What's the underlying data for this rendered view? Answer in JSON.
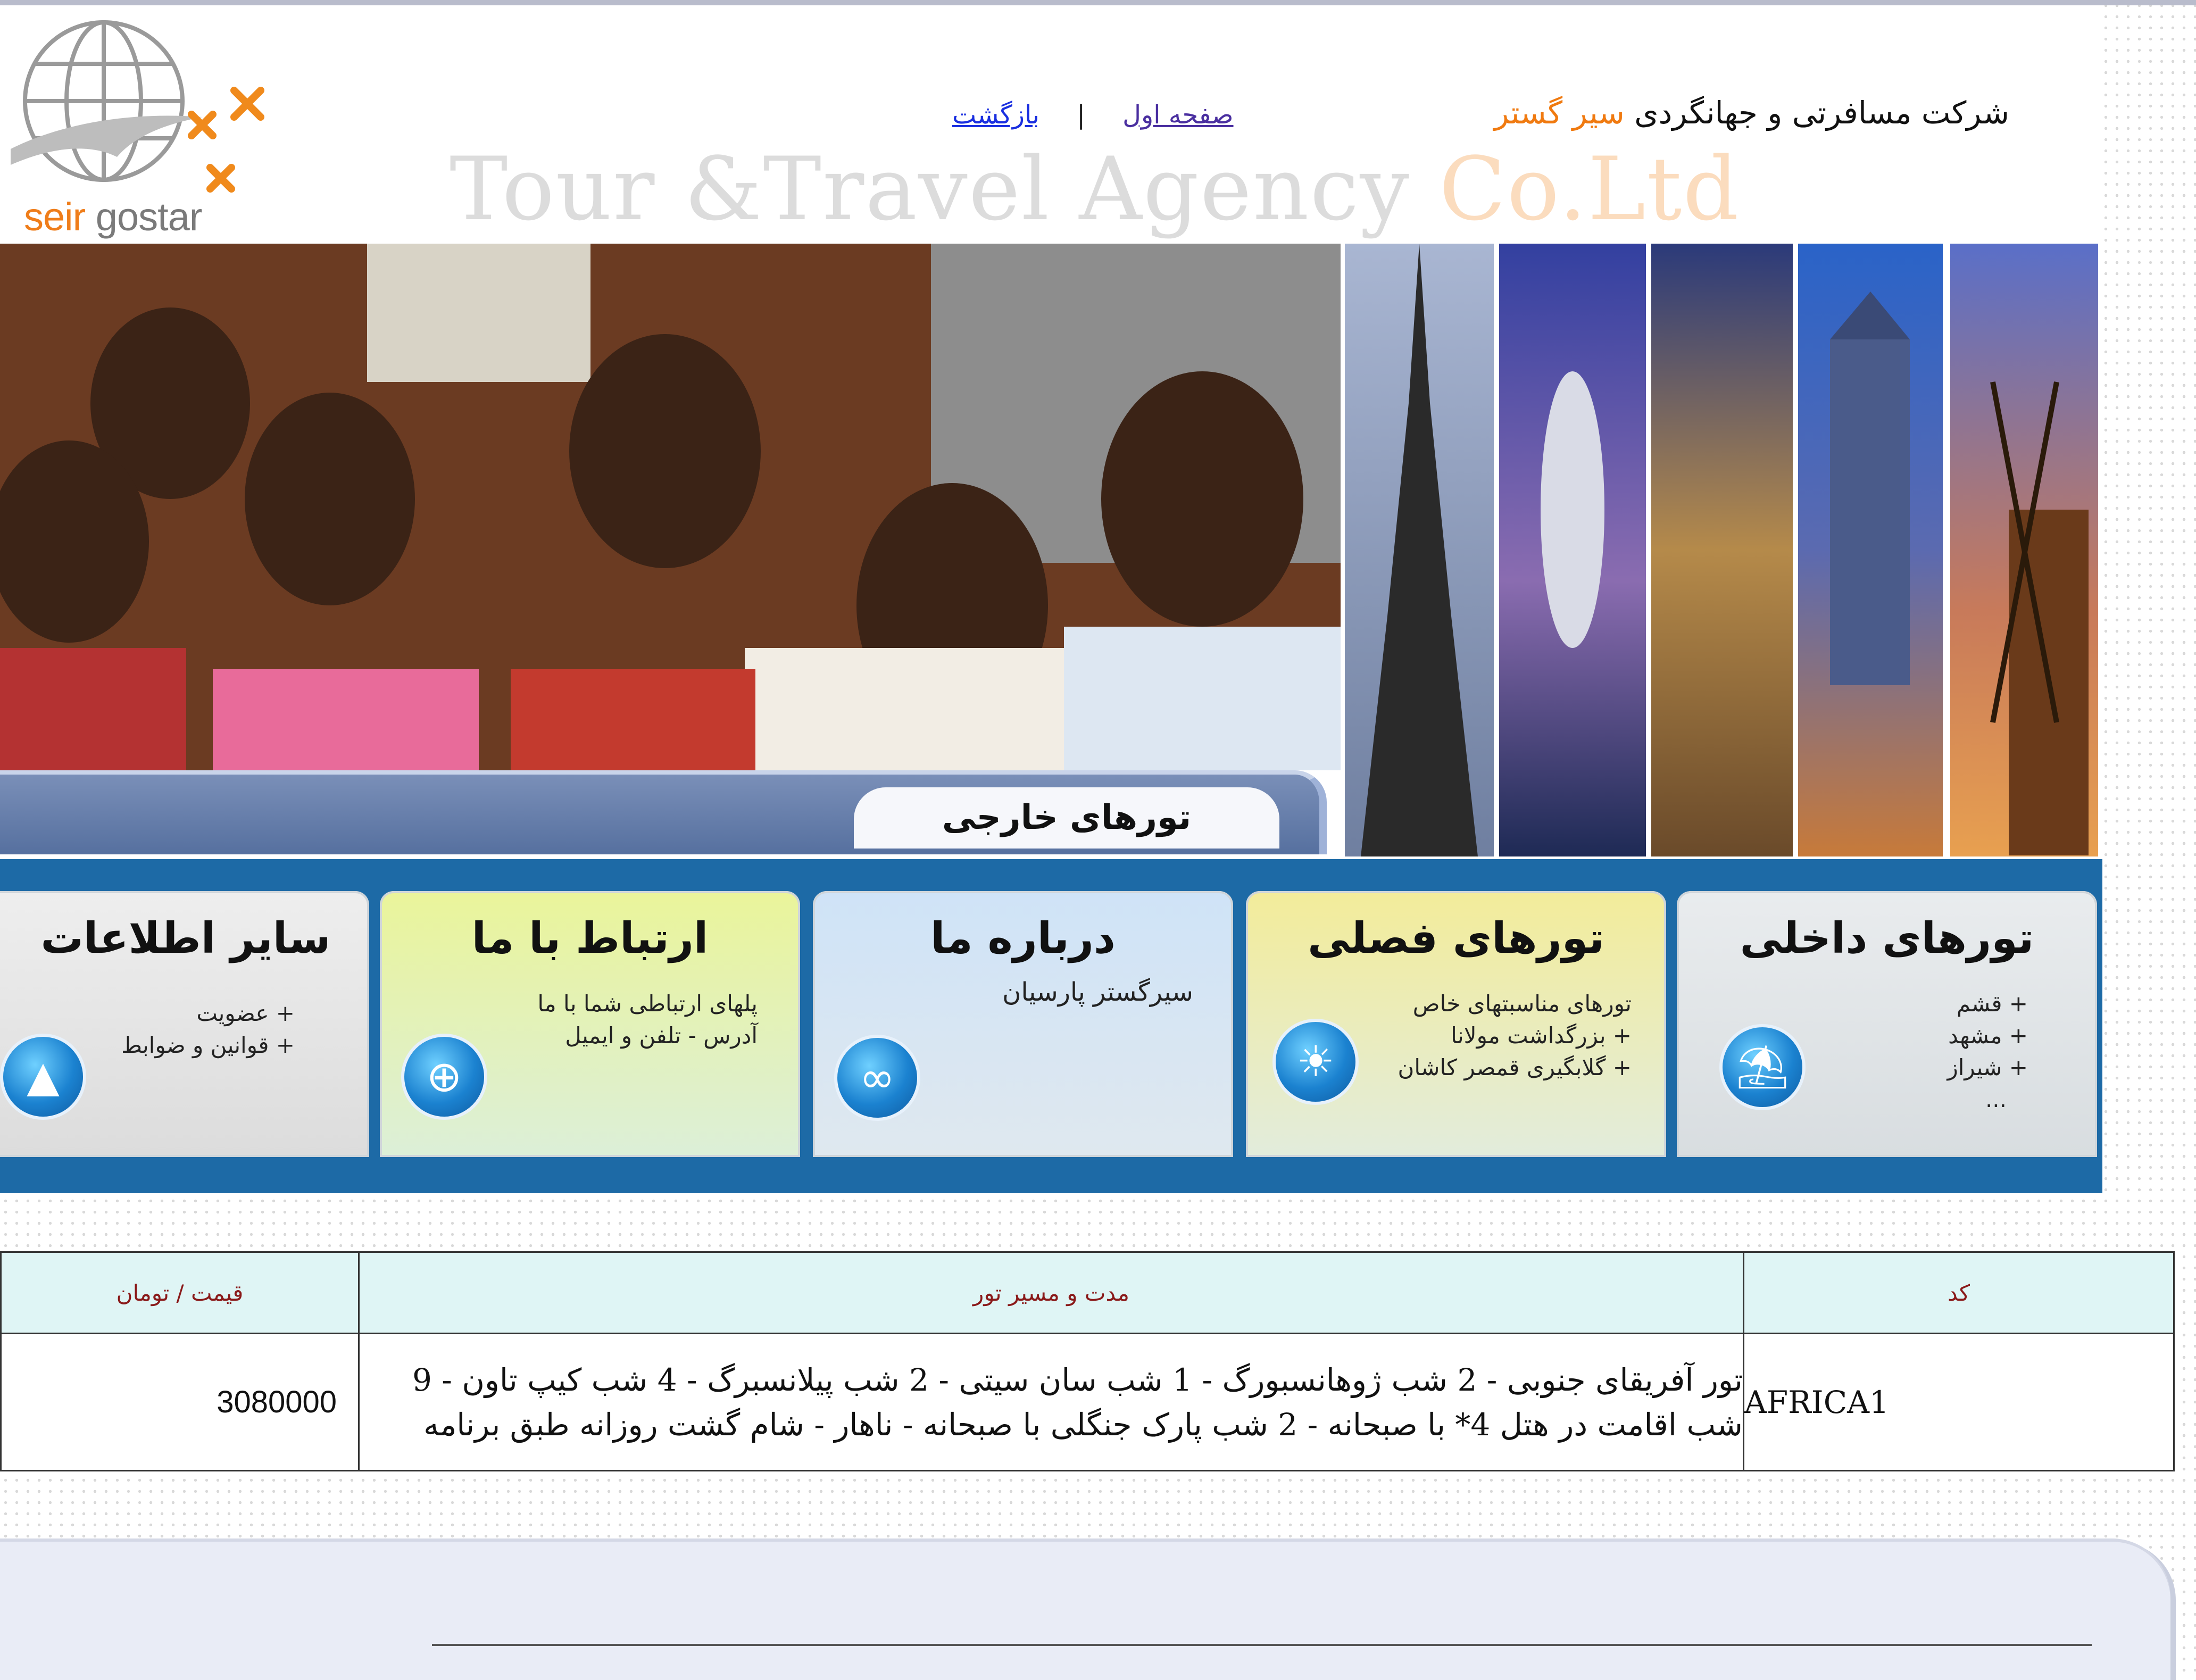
{
  "header": {
    "logo_left": "seir",
    "logo_right": " gostar",
    "company_prefix": "شرکت مسافرتی و جهانگردی",
    "company_brand": "سیر گستر",
    "nav_home": "صفحه اول",
    "nav_separator": "|",
    "nav_back": "بازگشت",
    "slogan_main": "Tour &Travel Agency",
    "slogan_accent": "Co.Ltd"
  },
  "banner": {
    "tab_label": "تورهای خارجی"
  },
  "categories": [
    {
      "title": "تورهای داخلی",
      "lines": [
        "+ قشم",
        "+ مشهد",
        "+ شیراز",
        "..."
      ],
      "icon": "palm-tree-icon"
    },
    {
      "title": "تورهای فصلی",
      "lines": [
        "تورهای مناسبتهای خاص",
        "+ بزرگداشت مولانا",
        "+ گلابگیری قمصر کاشان"
      ],
      "icon": "sun-icon"
    },
    {
      "title": "درباره ما",
      "lines": [
        "سیرگستر پارسیان"
      ],
      "icon": "glasses-icon"
    },
    {
      "title": "ارتباط با ما",
      "lines": [
        "پلهای ارتباطی شما با ما",
        "آدرس - تلفن و ایمیل"
      ],
      "icon": "globe-icon"
    },
    {
      "title": "سایر اطلاعات",
      "lines": [
        "+ عضویت",
        "+ قوانین و ضوابط"
      ],
      "icon": "tent-icon"
    }
  ],
  "table": {
    "headers": {
      "code": "کد",
      "description": "مدت و مسیر تور",
      "price": "قیمت / تومان"
    },
    "rows": [
      {
        "code": "AFRICA1",
        "description": "تور آفریقای جنوبی - 2 شب ژوهانسبورگ - 1 شب سان سیتی - 2 شب پیلانسبرگ - 4 شب کیپ تاون - 9 شب اقامت در هتل 4* با صبحانه - 2 شب پارک جنگلی با صبحانه - ناهار - شام گشت روزانه طبق برنامه",
        "price": "3080000"
      }
    ]
  }
}
